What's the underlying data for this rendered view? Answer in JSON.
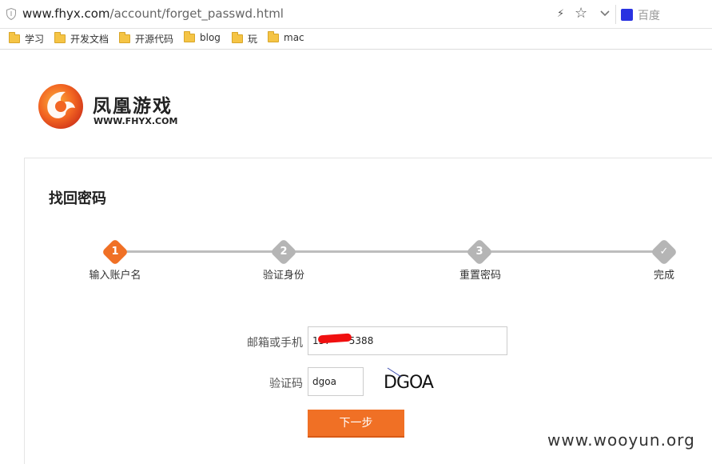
{
  "browser": {
    "url_host": "www.fhyx.com",
    "url_path": "/account/forget_passwd.html",
    "search_engine": "百度"
  },
  "bookmarks": [
    {
      "label": "学习"
    },
    {
      "label": "开发文档"
    },
    {
      "label": "开源代码"
    },
    {
      "label": "blog"
    },
    {
      "label": "玩"
    },
    {
      "label": "mac"
    }
  ],
  "brand": {
    "name_cn": "凤凰游戏",
    "name_en": "WWW.FHYX.COM"
  },
  "page": {
    "title": "找回密码"
  },
  "steps": [
    {
      "num": "1",
      "label": "输入账户名",
      "state": "active"
    },
    {
      "num": "2",
      "label": "验证身份",
      "state": "pending"
    },
    {
      "num": "3",
      "label": "重置密码",
      "state": "pending"
    },
    {
      "num": "✓",
      "label": "完成",
      "state": "pending"
    }
  ],
  "form": {
    "account_label": "邮箱或手机",
    "account_value": "137      5388",
    "captcha_label": "验证码",
    "captcha_value": "dgoa",
    "captcha_image_text": "DGOA",
    "next_button": "下一步"
  },
  "watermark": "www.wooyun.org",
  "colors": {
    "accent": "#f07025",
    "step_pending": "#b5b5b5"
  }
}
